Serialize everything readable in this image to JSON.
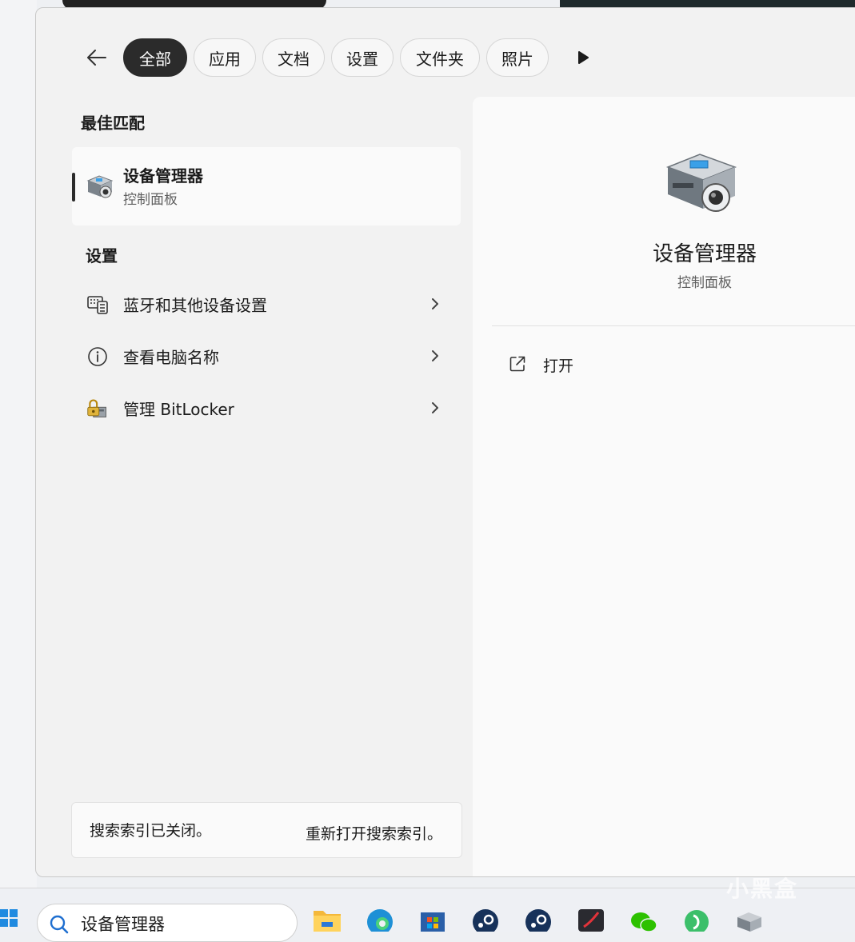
{
  "filters": {
    "tabs": [
      {
        "label": "全部",
        "active": true
      },
      {
        "label": "应用"
      },
      {
        "label": "文档"
      },
      {
        "label": "设置"
      },
      {
        "label": "文件夹"
      },
      {
        "label": "照片"
      }
    ]
  },
  "best_match": {
    "heading": "最佳匹配",
    "title": "设备管理器",
    "subtitle": "控制面板",
    "icon": "device-manager-icon"
  },
  "settings": {
    "heading": "设置",
    "items": [
      {
        "label": "蓝牙和其他设备设置",
        "icon": "keyboard-device-icon"
      },
      {
        "label": "查看电脑名称",
        "icon": "info-icon"
      },
      {
        "label": "管理 BitLocker",
        "icon": "bitlocker-icon"
      }
    ]
  },
  "index_notice": {
    "message": "搜索索引已关闭。",
    "link": "重新打开搜索索引。"
  },
  "detail": {
    "title": "设备管理器",
    "subtitle": "控制面板",
    "actions": [
      {
        "label": "打开",
        "icon": "open-external-icon"
      }
    ]
  },
  "taskbar": {
    "search_value": "设备管理器",
    "apps": [
      "file-explorer-icon",
      "edge-icon",
      "store-icon",
      "steam-icon",
      "steam-icon",
      "netease-icon",
      "wechat-icon",
      "green-app-icon",
      "device-manager-icon"
    ]
  },
  "watermark": "小黑盒",
  "colors": {
    "accent_dark": "#2b2b2b",
    "panel_bg": "#f2f2f2",
    "detail_bg": "#fafafa"
  }
}
